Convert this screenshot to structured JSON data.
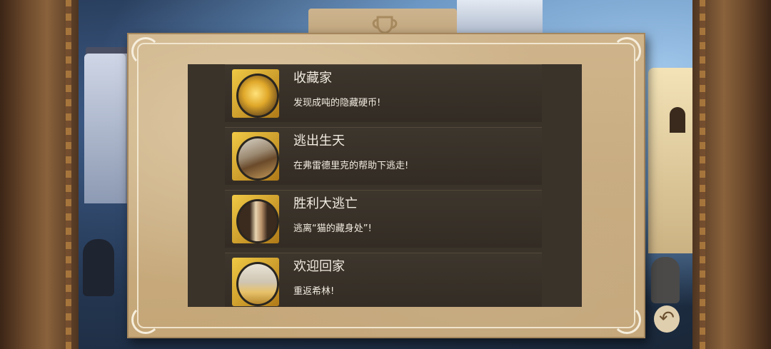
{
  "achievements": [
    {
      "title": "收藏家",
      "desc": "发现成吨的隐藏硬币!",
      "icon": "coins-icon"
    },
    {
      "title": "逃出生天",
      "desc": "在弗雷德里克的帮助下逃走!",
      "icon": "rope-ladder-icon"
    },
    {
      "title": "胜利大逃亡",
      "desc": "逃离“猫的藏身处”!",
      "icon": "ladder-icon"
    },
    {
      "title": "欢迎回家",
      "desc": "重返希林!",
      "icon": "pillar-icon"
    }
  ],
  "header": {
    "icon": "trophy-icon"
  },
  "nav": {
    "back_icon": "back-arrow-icon"
  },
  "colors": {
    "parchment": "#c9ad82",
    "panel": "#3a332a",
    "gold": "#e2b23a",
    "text": "#f1ece2"
  }
}
